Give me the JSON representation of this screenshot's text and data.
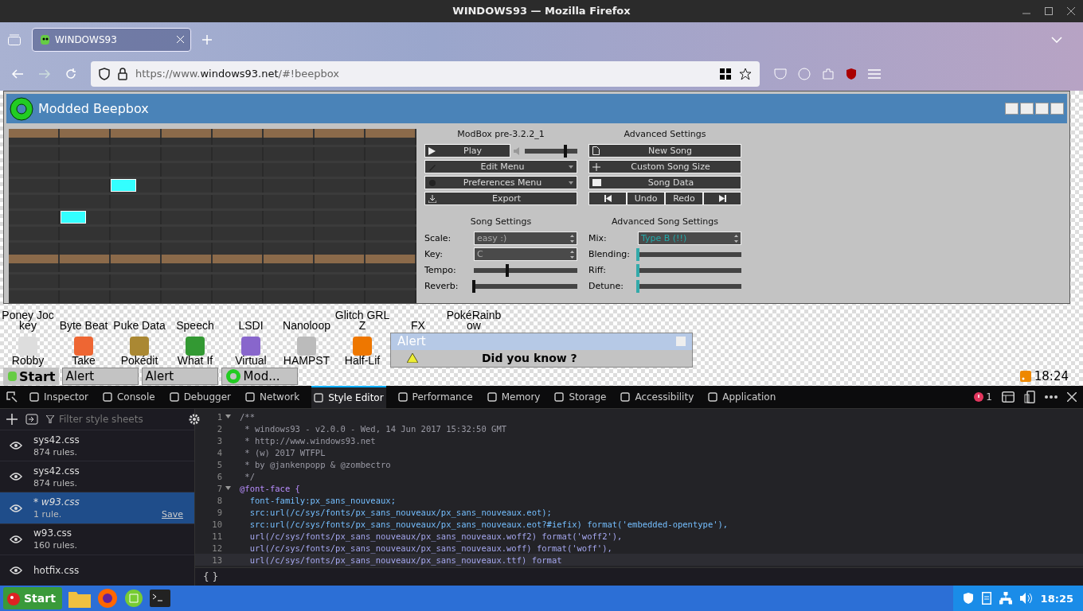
{
  "window": {
    "title": "WINDOWS93 — Mozilla Firefox"
  },
  "browser": {
    "tabs": [
      {
        "label": "WINDOWS93",
        "selected": true
      }
    ],
    "url": {
      "host_prefix": "https://www.",
      "domain": "windows93.net",
      "path": "/#!beepbox"
    }
  },
  "beepbox": {
    "title": "Modded Beepbox",
    "version": "ModBox pre-3.2.2_1",
    "play_label": "Play",
    "volume": {
      "level": 0.78
    },
    "menu_buttons": [
      {
        "label": "Edit Menu",
        "kind": "edit"
      },
      {
        "label": "Preferences Menu",
        "kind": "prefs"
      },
      {
        "label": "Export",
        "kind": "export"
      }
    ],
    "advanced_title": "Advanced Settings",
    "advanced_buttons": [
      {
        "label": "New Song",
        "kind": "new"
      },
      {
        "label": "Custom Song Size",
        "kind": "size"
      },
      {
        "label": "Song Data",
        "kind": "data"
      }
    ],
    "history": [
      "Undo",
      "Redo"
    ],
    "song_settings": {
      "title": "Song Settings",
      "rows": [
        {
          "label": "Scale:",
          "kind": "select",
          "value": "easy :)"
        },
        {
          "label": "Key:",
          "kind": "select",
          "value": "C"
        },
        {
          "label": "Tempo:",
          "kind": "slider",
          "level": 0.32
        },
        {
          "label": "Reverb:",
          "kind": "slider",
          "level": 0.0
        }
      ]
    },
    "advanced_song_settings": {
      "title": "Advanced Song Settings",
      "rows": [
        {
          "label": "Mix:",
          "kind": "select",
          "value": "Type B (!!)"
        },
        {
          "label": "Blending:",
          "kind": "slider",
          "level": 0.0
        },
        {
          "label": "Riff:",
          "kind": "slider",
          "level": 0.0
        },
        {
          "label": "Detune:",
          "kind": "slider",
          "level": 0.0
        }
      ]
    }
  },
  "desktop": {
    "rows": [
      [
        {
          "label": "Poney Jockey"
        },
        {
          "label": "Byte Beat"
        },
        {
          "label": "Puke Data"
        },
        {
          "label": "Speech"
        },
        {
          "label": "LSDI"
        },
        {
          "label": "Nanoloop"
        },
        {
          "label": "Glitch GRLZ"
        },
        {
          "label": "FX"
        },
        {
          "label": "PokéRainbow"
        }
      ],
      [
        {
          "label": "Robby"
        },
        {
          "label": "Take"
        },
        {
          "label": "Pokédit"
        },
        {
          "label": "What If"
        },
        {
          "label": "Virtual"
        },
        {
          "label": "HAMPST"
        },
        {
          "label": "Half-Lif"
        }
      ]
    ]
  },
  "alert": {
    "title": "Alert",
    "message": "Did you know ?"
  },
  "w93_taskbar": {
    "start": "Start",
    "items": [
      {
        "label": "Alert",
        "kind": "plain"
      },
      {
        "label": "Alert",
        "kind": "plain"
      },
      {
        "label": "Mod...",
        "kind": "app"
      }
    ],
    "clock": "18:24"
  },
  "devtools": {
    "tabs": [
      {
        "label": "Inspector",
        "selected": false
      },
      {
        "label": "Console",
        "selected": false
      },
      {
        "label": "Debugger",
        "selected": false
      },
      {
        "label": "Network",
        "selected": false
      },
      {
        "label": "Style Editor",
        "selected": true
      },
      {
        "label": "Performance",
        "selected": false
      },
      {
        "label": "Memory",
        "selected": false
      },
      {
        "label": "Storage",
        "selected": false
      },
      {
        "label": "Accessibility",
        "selected": false
      },
      {
        "label": "Application",
        "selected": false
      }
    ],
    "error_count": "1",
    "filter_placeholder": "Filter style sheets",
    "stylesheets": [
      {
        "name": "sys42.css",
        "rules": "874 rules.",
        "selected": false,
        "modified": false
      },
      {
        "name": "sys42.css",
        "rules": "874 rules.",
        "selected": false,
        "modified": false
      },
      {
        "name": "* w93.css",
        "rules": "1 rule.",
        "selected": true,
        "modified": true,
        "save": "Save"
      },
      {
        "name": "w93.css",
        "rules": "160 rules.",
        "selected": false,
        "modified": false
      },
      {
        "name": "hotfix.css",
        "selected": false,
        "modified": false
      }
    ],
    "lines": [
      {
        "number": "1",
        "text": "/**",
        "kind": "comment",
        "foldable": true,
        "current": false
      },
      {
        "number": "2",
        "text": " * windows93 - v2.0.0 - Wed, 14 Jun 2017 15:32:50 GMT",
        "kind": "comment",
        "foldable": false,
        "current": false
      },
      {
        "number": "3",
        "text": " * http://www.windows93.net",
        "kind": "comment",
        "foldable": false,
        "current": false
      },
      {
        "number": "4",
        "text": " * (w) 2017 WTFPL",
        "kind": "comment",
        "foldable": false,
        "current": false
      },
      {
        "number": "5",
        "text": " * by @jankenpopp & @zombectro",
        "kind": "comment",
        "foldable": false,
        "current": false
      },
      {
        "number": "6",
        "text": " */",
        "kind": "comment",
        "foldable": false,
        "current": false
      },
      {
        "number": "7",
        "text": "@font-face {",
        "kind": "rule",
        "foldable": true,
        "current": false
      },
      {
        "number": "8",
        "text": "  font-family:px_sans_nouveaux;",
        "kind": "prop",
        "foldable": false,
        "current": false
      },
      {
        "number": "9",
        "text": "  src:url(/c/sys/fonts/px_sans_nouveaux/px_sans_nouveaux.eot);",
        "kind": "prop",
        "foldable": false,
        "current": false
      },
      {
        "number": "10",
        "text": "  src:url(/c/sys/fonts/px_sans_nouveaux/px_sans_nouveaux.eot?#iefix) format('embedded-opentype'),",
        "kind": "prop",
        "foldable": false,
        "current": false
      },
      {
        "number": "11",
        "text": "  url(/c/sys/fonts/px_sans_nouveaux/px_sans_nouveaux.woff2) format('woff2'),",
        "kind": "value",
        "foldable": false,
        "current": false
      },
      {
        "number": "12",
        "text": "  url(/c/sys/fonts/px_sans_nouveaux/px_sans_nouveaux.woff) format('woff'),",
        "kind": "value",
        "foldable": false,
        "current": false
      },
      {
        "number": "13",
        "text": "  url(/c/sys/fonts/px_sans_nouveaux/px_sans_nouveaux.ttf) format",
        "kind": "value",
        "foldable": false,
        "current": true
      }
    ],
    "footer": "{ }"
  },
  "os_taskbar": {
    "start": "Start",
    "clock": "18:25"
  }
}
